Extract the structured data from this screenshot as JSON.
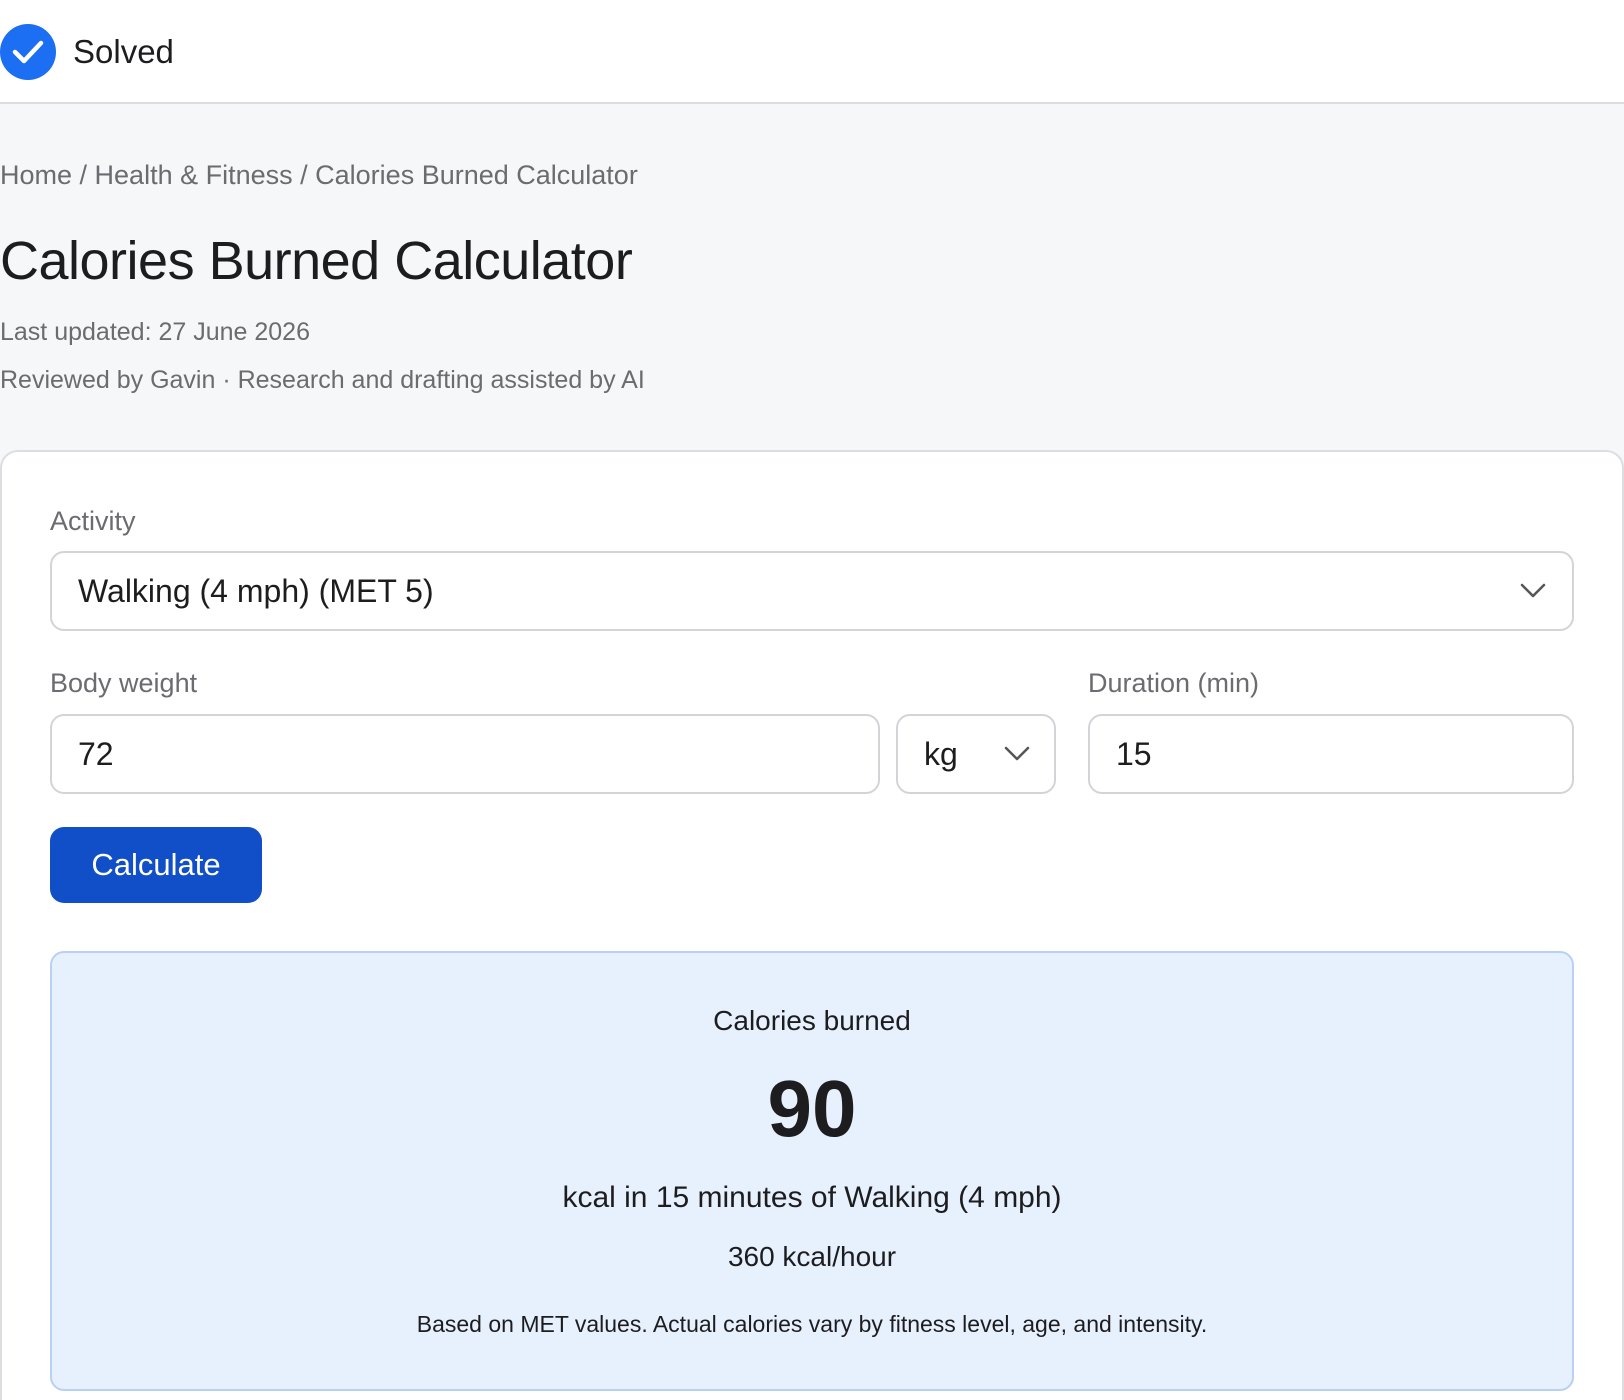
{
  "status": {
    "label": "Solved"
  },
  "breadcrumb": {
    "home": "Home",
    "sep1": " / ",
    "category": "Health & Fitness",
    "sep2": " / ",
    "current": "Calories Burned Calculator"
  },
  "page": {
    "title": "Calories Burned Calculator",
    "last_updated": "Last updated: 27 June 2026",
    "reviewed": "Reviewed by Gavin · Research and drafting assisted by AI"
  },
  "form": {
    "activity_label": "Activity",
    "activity_value": "Walking (4 mph) (MET 5)",
    "weight_label": "Body weight",
    "weight_value": "72",
    "weight_unit": "kg",
    "duration_label": "Duration (min)",
    "duration_value": "15",
    "calculate_label": "Calculate"
  },
  "result": {
    "heading": "Calories burned",
    "value": "90",
    "summary": "kcal in 15 minutes of Walking (4 mph)",
    "rate": "360 kcal/hour",
    "note": "Based on MET values. Actual calories vary by fitness level, age, and intensity."
  },
  "colors": {
    "accent": "#114fc9",
    "solved_icon": "#1c6ef2",
    "result_bg": "#e7f0fd"
  },
  "icons": {
    "status": "check-circle-icon",
    "select": "chevron-down-icon"
  }
}
